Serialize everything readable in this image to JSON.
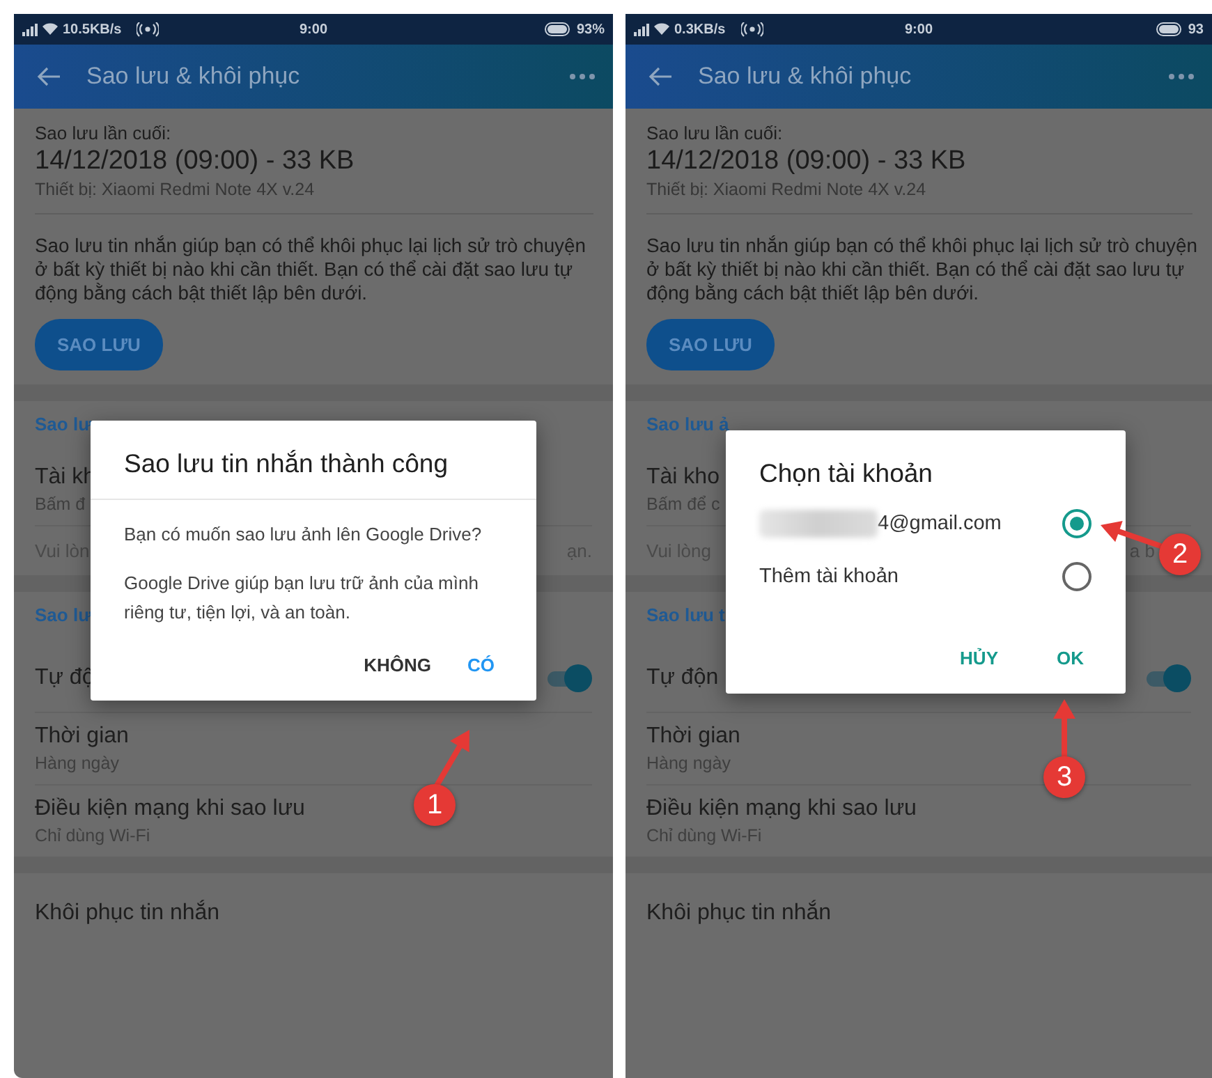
{
  "phones": [
    {
      "status_bar": {
        "speed": "10.5KB/s",
        "time": "9:00",
        "battery": "93%"
      },
      "app_bar": {
        "title": "Sao lưu & khôi phục"
      },
      "last_backup": {
        "label": "Sao lưu lần cuối:",
        "value": "14/12/2018 (09:00) - 33 KB",
        "device": "Thiết bị: Xiaomi Redmi Note 4X v.24"
      },
      "description": "Sao lưu tin nhắn giúp bạn có thể khôi phục lại lịch sử trò chuyện ở bất kỳ thiết bị nào khi cần thiết. Bạn có thể cài đặt sao lưu tự động bằng cách bật thiết lập bên dưới.",
      "backup_button": "SAO LƯU",
      "sections": [
        {
          "header": "Sao lư",
          "rows": [
            {
              "kind": "item",
              "title": "Tài kh",
              "subtitle": "Bấm đ"
            },
            {
              "kind": "note",
              "text": "Vui lòn",
              "tail": "ạn."
            }
          ]
        },
        {
          "header": "Sao lư",
          "rows": [
            {
              "kind": "toggle",
              "title": "Tự độ",
              "on": true
            },
            {
              "kind": "item",
              "title": "Thời gian",
              "subtitle": "Hàng ngày"
            },
            {
              "kind": "item",
              "title": "Điều kiện mạng khi sao lưu",
              "subtitle": "Chỉ dùng Wi-Fi"
            }
          ]
        },
        {
          "rows": [
            {
              "kind": "item",
              "title": "Khôi phục tin nhắn"
            }
          ]
        }
      ],
      "dialog": {
        "kind": "message",
        "title": "Sao lưu tin nhắn thành công",
        "paragraphs": [
          "Bạn có muốn sao lưu ảnh lên Google Drive?",
          "Google Drive giúp bạn lưu trữ ảnh của mình riêng tư, tiện lợi, và an toàn."
        ],
        "buttons": [
          {
            "label": "KHÔNG",
            "primary": false
          },
          {
            "label": "CÓ",
            "primary": true
          }
        ]
      },
      "annotations": [
        {
          "number": "1"
        }
      ]
    },
    {
      "status_bar": {
        "speed": "0.3KB/s",
        "time": "9:00",
        "battery": "93"
      },
      "app_bar": {
        "title": "Sao lưu & khôi phục"
      },
      "last_backup": {
        "label": "Sao lưu lần cuối:",
        "value": "14/12/2018 (09:00) - 33 KB",
        "device": "Thiết bị: Xiaomi Redmi Note 4X v.24"
      },
      "description": "Sao lưu tin nhắn giúp bạn có thể khôi phục lại lịch sử trò chuyện ở bất kỳ thiết bị nào khi cần thiết. Bạn có thể cài đặt sao lưu tự động bằng cách bật thiết lập bên dưới.",
      "backup_button": "SAO LƯU",
      "sections": [
        {
          "header": "Sao lưu ả",
          "rows": [
            {
              "kind": "item",
              "title": "Tài kho",
              "subtitle": "Bấm để c"
            },
            {
              "kind": "note",
              "text": "Vui lòng",
              "tail": "a b"
            }
          ]
        },
        {
          "header": "Sao lưu t",
          "rows": [
            {
              "kind": "toggle",
              "title": "Tự độn",
              "on": true
            },
            {
              "kind": "item",
              "title": "Thời gian",
              "subtitle": "Hàng ngày"
            },
            {
              "kind": "item",
              "title": "Điều kiện mạng khi sao lưu",
              "subtitle": "Chỉ dùng Wi-Fi"
            }
          ]
        },
        {
          "rows": [
            {
              "kind": "item",
              "title": "Khôi phục tin nhắn"
            }
          ]
        }
      ],
      "dialog": {
        "kind": "choice",
        "title": "Chọn tài khoản",
        "options": [
          {
            "label": "4@gmail.com",
            "redacted": true,
            "selected": true
          },
          {
            "label": "Thêm tài khoản",
            "redacted": false,
            "selected": false
          }
        ],
        "buttons": [
          {
            "label": "HỦY",
            "primary": true
          },
          {
            "label": "OK",
            "primary": true
          }
        ]
      },
      "annotations": [
        {
          "number": "2"
        },
        {
          "number": "3"
        }
      ]
    }
  ]
}
